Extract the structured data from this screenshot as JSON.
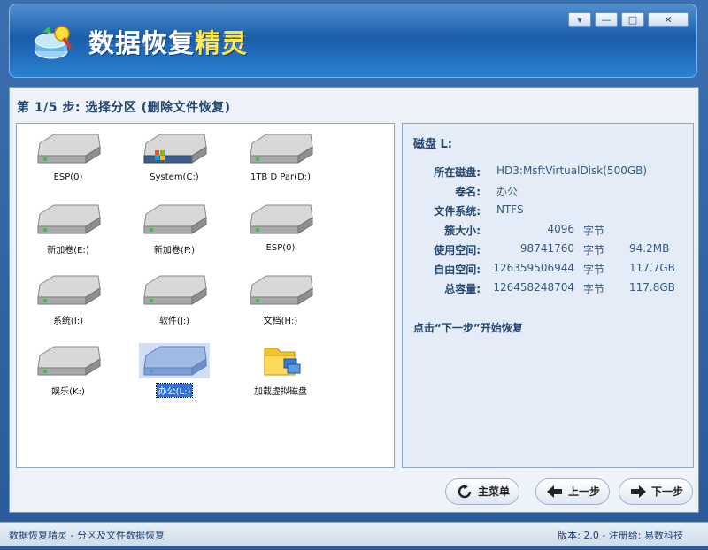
{
  "app": {
    "title_main": "数据恢复",
    "title_accent": "精灵"
  },
  "window_controls": [
    "▾",
    "—",
    "□",
    "✕"
  ],
  "step": {
    "title": "第 1/5 步: 选择分区 (删除文件恢复)"
  },
  "drives": [
    {
      "label": "ESP(0)",
      "icon": "drive-icon"
    },
    {
      "label": "System(C:)",
      "icon": "windows-drive-icon"
    },
    {
      "label": "1TB D Par(D:)",
      "icon": "drive-icon"
    },
    {
      "label": "新加卷(E:)",
      "icon": "drive-icon"
    },
    {
      "label": "新加卷(F:)",
      "icon": "drive-icon"
    },
    {
      "label": "ESP(0)",
      "icon": "drive-icon"
    },
    {
      "label": "系统(I:)",
      "icon": "drive-icon"
    },
    {
      "label": "软件(J:)",
      "icon": "drive-icon"
    },
    {
      "label": "文档(H:)",
      "icon": "drive-icon"
    },
    {
      "label": "娱乐(K:)",
      "icon": "drive-icon"
    },
    {
      "label": "办公(L:)",
      "icon": "drive-icon",
      "selected": true
    },
    {
      "label": "加载虚拟磁盘",
      "icon": "folder-virtual-disk-icon"
    }
  ],
  "disk_info": {
    "title": "磁盘 L:",
    "disk_key": "所在磁盘:",
    "disk_value": "HD3:MsftVirtualDisk(500GB)",
    "volume_key": "卷名:",
    "volume_value": "办公",
    "fs_key": "文件系统:",
    "fs_value": "NTFS",
    "cluster_key": "簇大小:",
    "cluster_value": "4096",
    "cluster_unit": "字节",
    "used_key": "使用空间:",
    "used_value": "98741760",
    "used_unit": "字节",
    "used_size": "94.2MB",
    "free_key": "自由空间:",
    "free_value": "126359506944",
    "free_unit": "字节",
    "free_size": "117.7GB",
    "total_key": "总容量:",
    "total_value": "126458248704",
    "total_unit": "字节",
    "total_size": "117.8GB"
  },
  "hint": "点击“下一步”开始恢复",
  "buttons": {
    "main_menu": "主菜单",
    "prev": "上一步",
    "next": "下一步"
  },
  "status": {
    "left": "数据恢复精灵 - 分区及文件数据恢复",
    "right": "版本: 2.0 - 注册给: 易数科技"
  },
  "colors": {
    "header_blue": "#1a5cab",
    "accent_yellow": "#ffe43a",
    "selection": "#3170d3"
  }
}
